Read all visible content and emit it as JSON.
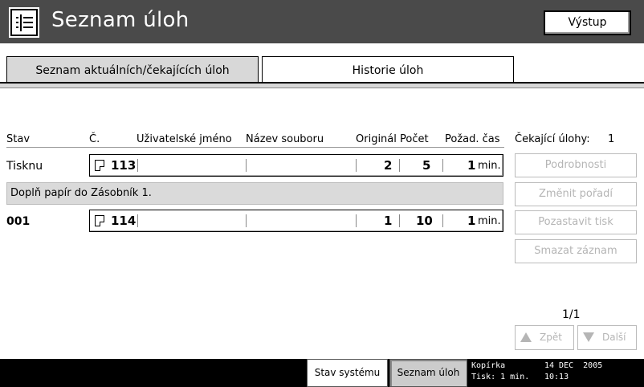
{
  "header": {
    "title": "Seznam úloh",
    "exit_label": "Výstup",
    "icon": "job-list-icon"
  },
  "tabs": [
    {
      "label": "Seznam aktuálních/čekajících úloh",
      "active": true
    },
    {
      "label": "Historie úloh",
      "active": false
    }
  ],
  "table": {
    "columns": {
      "status": "Stav",
      "number": "Č.",
      "user": "Uživatelské jméno",
      "file": "Název souboru",
      "original": "Originál",
      "count": "Počet",
      "time": "Požad. čas"
    },
    "rows": [
      {
        "status": "Tisknu",
        "number": "113",
        "user": "",
        "file": "",
        "original": "2",
        "count": "5",
        "time": "1",
        "unit": "min."
      },
      {
        "status": "001",
        "number": "114",
        "user": "",
        "file": "",
        "original": "1",
        "count": "10",
        "time": "1",
        "unit": "min."
      }
    ],
    "message": "Doplň papír do Zásobník 1."
  },
  "sidebar": {
    "waiting_label": "Čekající úlohy:",
    "waiting_count": "1",
    "buttons": [
      {
        "label": "Podrobnosti"
      },
      {
        "label": "Změnit pořadí"
      },
      {
        "label": "Pozastavit tisk"
      },
      {
        "label": "Smazat záznam"
      }
    ],
    "page_indicator": "1/1",
    "prev_label": "Zpět",
    "next_label": "Další"
  },
  "footer": {
    "system_status_label": "Stav systému",
    "job_list_label": "Seznam úloh",
    "mode_line1": "Kopírka",
    "mode_line2": "Tisk: 1 min.",
    "date": "14 DEC  2005",
    "time": "10:13"
  },
  "colors": {
    "header_bg": "#4a4a4a",
    "disabled_text": "#b5b5b5",
    "message_bg": "#dadada",
    "footer_bg": "#000000"
  }
}
